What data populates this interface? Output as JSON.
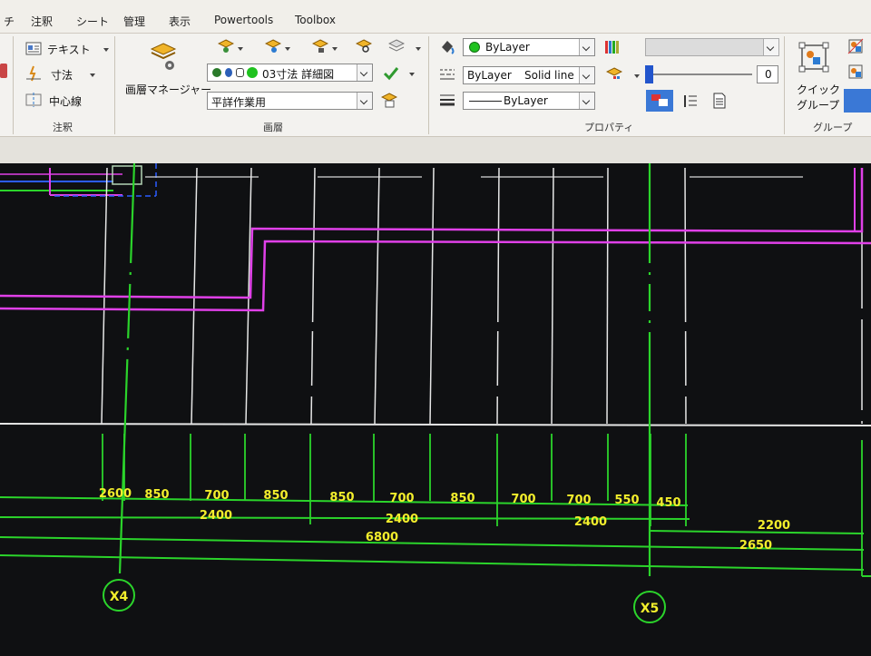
{
  "tabs": [
    "チ",
    "注釈",
    "シート",
    "管理",
    "表示",
    "Powertools",
    "Toolbox"
  ],
  "annotation_panel": {
    "text_label": "テキスト",
    "dimension_label": "寸法",
    "centerline_label": "中心線",
    "title": "注釈"
  },
  "layers_panel": {
    "layer_manager_label": "画層マネージャー",
    "current_layer": "03寸法 詳細図",
    "layer_state": "平詳作業用",
    "title": "画層"
  },
  "properties_panel": {
    "color": "ByLayer",
    "linetype_bylayer": "ByLayer",
    "linetype_name": "Solid line",
    "lineweight": "ByLayer",
    "transparency_value": "0",
    "title": "プロパティ"
  },
  "groups_panel": {
    "quick_group_line1": "クイック",
    "quick_group_line2": "グループ",
    "title": "グループ"
  },
  "colors": {
    "drawing_bg": "#0f1012",
    "dimension_line": "#2bd42b",
    "dimension_text": "#f3ee2c",
    "wall_line": "#e040e8",
    "gridline": "#e6e6e6"
  },
  "drawing": {
    "row1": [
      "2600",
      "850",
      "700",
      "850",
      "850",
      "700",
      "850",
      "700",
      "700",
      "550",
      "450"
    ],
    "row2": [
      "2400",
      "2400",
      "2400",
      "2200"
    ],
    "row3": [
      "6800",
      "2650"
    ],
    "grid_labels": [
      "X4",
      "X5"
    ]
  }
}
